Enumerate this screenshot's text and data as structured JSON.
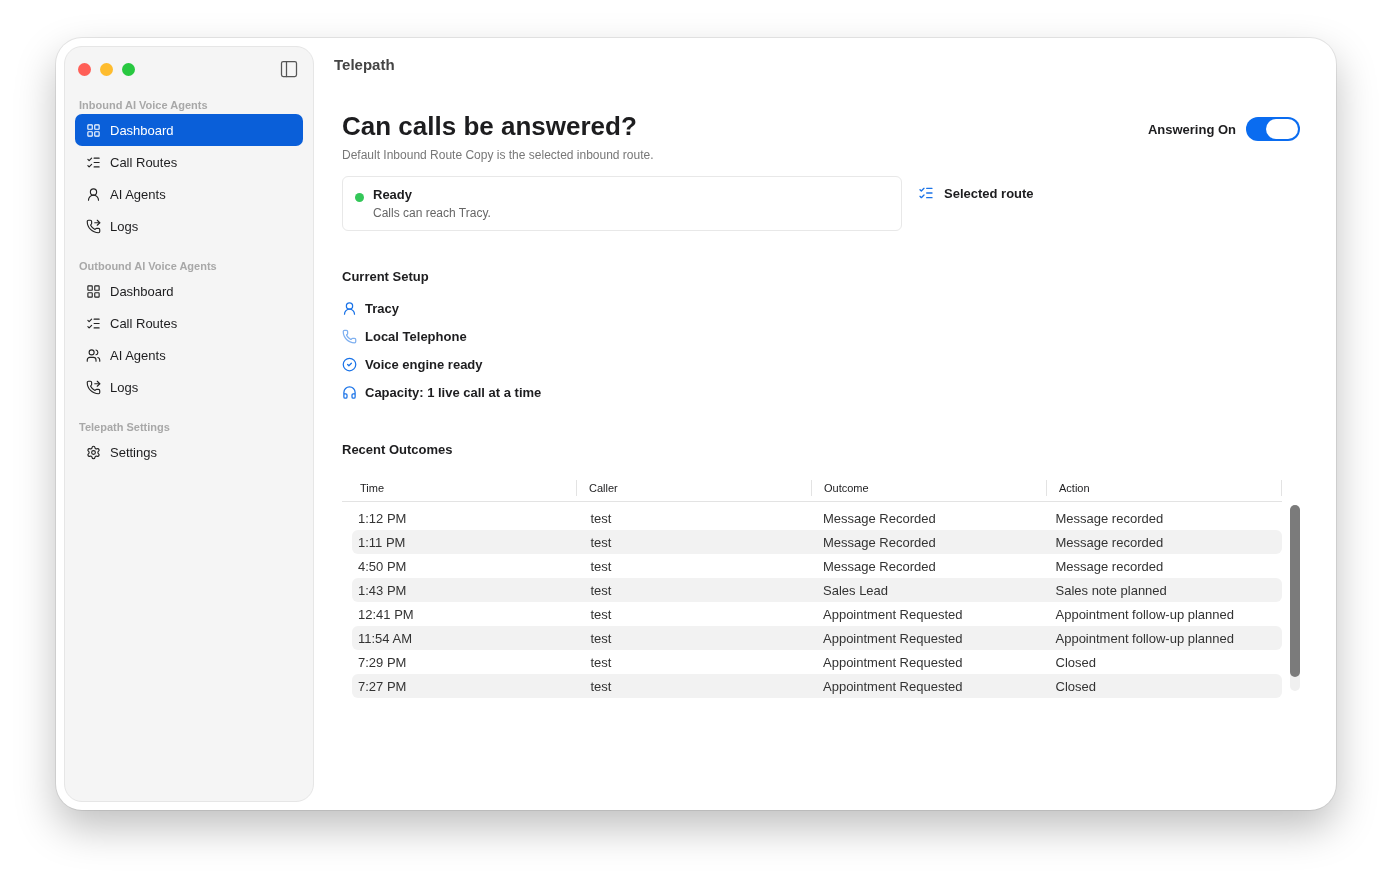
{
  "window": {
    "title": "Telepath"
  },
  "sidebar": {
    "sections": [
      {
        "heading": "Inbound AI Voice Agents",
        "items": [
          {
            "label": "Dashboard",
            "kind": "dashboard",
            "selected": true
          },
          {
            "label": "Call Routes",
            "kind": "routes",
            "selected": false
          },
          {
            "label": "AI Agents",
            "kind": "agent",
            "selected": false
          },
          {
            "label": "Logs",
            "kind": "logs",
            "selected": false
          }
        ]
      },
      {
        "heading": "Outbound AI Voice Agents",
        "items": [
          {
            "label": "Dashboard",
            "kind": "dashboard",
            "selected": false
          },
          {
            "label": "Call Routes",
            "kind": "routes",
            "selected": false
          },
          {
            "label": "AI Agents",
            "kind": "agents",
            "selected": false
          },
          {
            "label": "Logs",
            "kind": "logs",
            "selected": false
          }
        ]
      },
      {
        "heading": "Telepath Settings",
        "items": [
          {
            "label": "Settings",
            "kind": "settings",
            "selected": false
          }
        ]
      }
    ]
  },
  "header": {
    "title": "Can calls be answered?",
    "subtitle": "Default Inbound Route Copy is the selected inbound route.",
    "toggle": {
      "label": "Answering On",
      "on": true
    }
  },
  "status": {
    "title": "Ready",
    "text": "Calls can reach Tracy.",
    "ok": true
  },
  "selected_route": {
    "label": "Selected route"
  },
  "setup": {
    "heading": "Current Setup",
    "items": [
      {
        "label": "Tracy",
        "kind": "agent"
      },
      {
        "label": "Local Telephone",
        "kind": "telephone"
      },
      {
        "label": "Voice engine ready",
        "kind": "check"
      },
      {
        "label": "Capacity: 1 live call at a time",
        "kind": "headset"
      }
    ]
  },
  "outcomes": {
    "heading": "Recent Outcomes",
    "columns": [
      "Time",
      "Caller",
      "Outcome",
      "Action"
    ],
    "rows": [
      [
        "1:12 PM",
        "test",
        "Message Recorded",
        "Message recorded"
      ],
      [
        "1:11 PM",
        "test",
        "Message Recorded",
        "Message recorded"
      ],
      [
        "4:50 PM",
        "test",
        "Message Recorded",
        "Message recorded"
      ],
      [
        "1:43 PM",
        "test",
        "Sales Lead",
        "Sales note planned"
      ],
      [
        "12:41 PM",
        "test",
        "Appointment Requested",
        "Appointment follow-up planned"
      ],
      [
        "11:54 AM",
        "test",
        "Appointment Requested",
        "Appointment follow-up planned"
      ],
      [
        "7:29 PM",
        "test",
        "Appointment Requested",
        "Closed"
      ],
      [
        "7:27 PM",
        "test",
        "Appointment Requested",
        "Closed"
      ]
    ]
  }
}
